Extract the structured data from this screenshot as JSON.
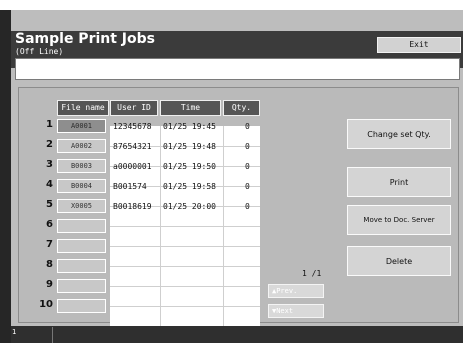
{
  "header": {
    "title": "Sample Print Jobs",
    "subtitle": "(Off Line)",
    "exit_label": "Exit"
  },
  "table": {
    "columns": [
      "File name",
      "User ID",
      "Time",
      "Qty."
    ],
    "rows": [
      {
        "num": "1",
        "file": "A0001",
        "user": "12345678",
        "time": "01/25 19:45",
        "qty": "0",
        "selected": true
      },
      {
        "num": "2",
        "file": "A0002",
        "user": "87654321",
        "time": "01/25 19:48",
        "qty": "0",
        "selected": false
      },
      {
        "num": "3",
        "file": "B0003",
        "user": "a0000001",
        "time": "01/25 19:50",
        "qty": "0",
        "selected": false
      },
      {
        "num": "4",
        "file": "B0004",
        "user": "B001574",
        "time": "01/25 19:58",
        "qty": "0",
        "selected": false
      },
      {
        "num": "5",
        "file": "X0005",
        "user": "B0018619",
        "time": "01/25 20:00",
        "qty": "0",
        "selected": false
      },
      {
        "num": "6",
        "file": "",
        "user": "",
        "time": "",
        "qty": "",
        "selected": false
      },
      {
        "num": "7",
        "file": "",
        "user": "",
        "time": "",
        "qty": "",
        "selected": false
      },
      {
        "num": "8",
        "file": "",
        "user": "",
        "time": "",
        "qty": "",
        "selected": false
      },
      {
        "num": "9",
        "file": "",
        "user": "",
        "time": "",
        "qty": "",
        "selected": false
      },
      {
        "num": "10",
        "file": "",
        "user": "",
        "time": "",
        "qty": "",
        "selected": false
      }
    ]
  },
  "actions": {
    "change_qty": "Change set Qty.",
    "print": "Print",
    "move": "Move to Doc. Server",
    "delete": "Delete"
  },
  "pagination": {
    "page": "1 /1",
    "prev": "▲Prev.",
    "next": "▼Next"
  },
  "counter": "1"
}
